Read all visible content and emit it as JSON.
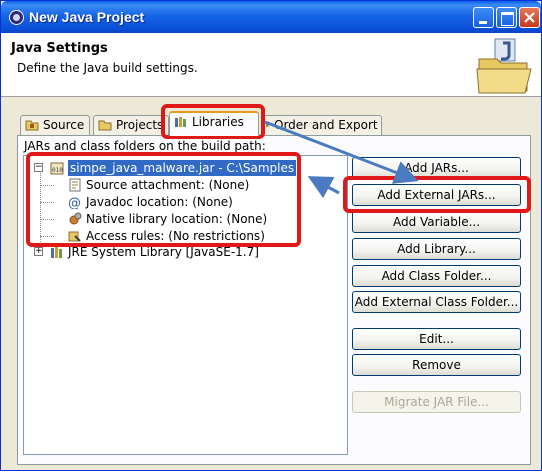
{
  "window": {
    "title": "New Java Project"
  },
  "header": {
    "title": "Java Settings",
    "description": "Define the Java build settings."
  },
  "tabs": [
    {
      "label": "Source",
      "icon": "source-folder-icon"
    },
    {
      "label": "Projects",
      "icon": "projects-folder-icon"
    },
    {
      "label": "Libraries",
      "icon": "libraries-icon",
      "active": true
    },
    {
      "label": "Order and Export",
      "icon": "order-export-icon"
    }
  ],
  "libraries": {
    "label": "JARs and class folders on the build path:",
    "tree": {
      "jar": "simpe_java_malware.jar - C:\\Samples",
      "children": [
        "Source attachment: (None)",
        "Javadoc location: (None)",
        "Native library location: (None)",
        "Access rules: (No restrictions)"
      ],
      "system_library": "JRE System Library [JavaSE-1.7]"
    },
    "buttons": {
      "add_jars": "Add JARs...",
      "add_external_jars": "Add External JARs...",
      "add_variable": "Add Variable...",
      "add_library": "Add Library...",
      "add_class_folder": "Add Class Folder...",
      "add_external_class_folder": "Add External Class Folder...",
      "edit": "Edit...",
      "remove": "Remove",
      "migrate_jar": "Migrate JAR File..."
    }
  },
  "colors": {
    "highlight": "#e01818",
    "arrow": "#4a7ac0",
    "selection": "#316ac5"
  }
}
